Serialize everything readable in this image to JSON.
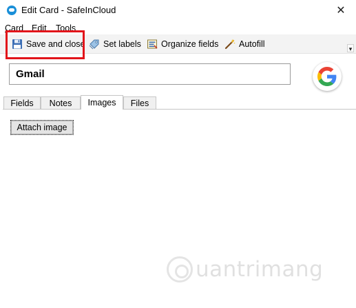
{
  "window": {
    "title": "Edit Card - SafeInCloud",
    "close_glyph": "✕",
    "app_icon": "safeincloud-icon"
  },
  "menu": [
    {
      "label_ul": "C",
      "label_rest": "ard"
    },
    {
      "label_ul": "E",
      "label_rest": "dit"
    },
    {
      "label_ul": "T",
      "label_rest": "ools"
    }
  ],
  "toolbar": {
    "save": {
      "label": "Save and close",
      "icon": "floppy-disk-icon"
    },
    "labels": {
      "label": "Set labels",
      "icon": "tag-icon"
    },
    "organize": {
      "label": "Organize fields",
      "icon": "organize-icon"
    },
    "autofill": {
      "label": "Autofill",
      "icon": "magic-wand-icon"
    },
    "overflow_glyph": "▾"
  },
  "card": {
    "name": "Gmail",
    "logo": "google-logo-icon"
  },
  "tabs": [
    {
      "label": "Fields",
      "active": false
    },
    {
      "label": "Notes",
      "active": false
    },
    {
      "label": "Images",
      "active": true
    },
    {
      "label": "Files",
      "active": false
    }
  ],
  "images_tab": {
    "attach_label": "Attach image"
  },
  "watermark": {
    "text": "uantrimang"
  },
  "colors": {
    "highlight": "#e2141a",
    "toolbar_bg": "#f3f3f3",
    "app_blue": "#1a8fd8"
  }
}
